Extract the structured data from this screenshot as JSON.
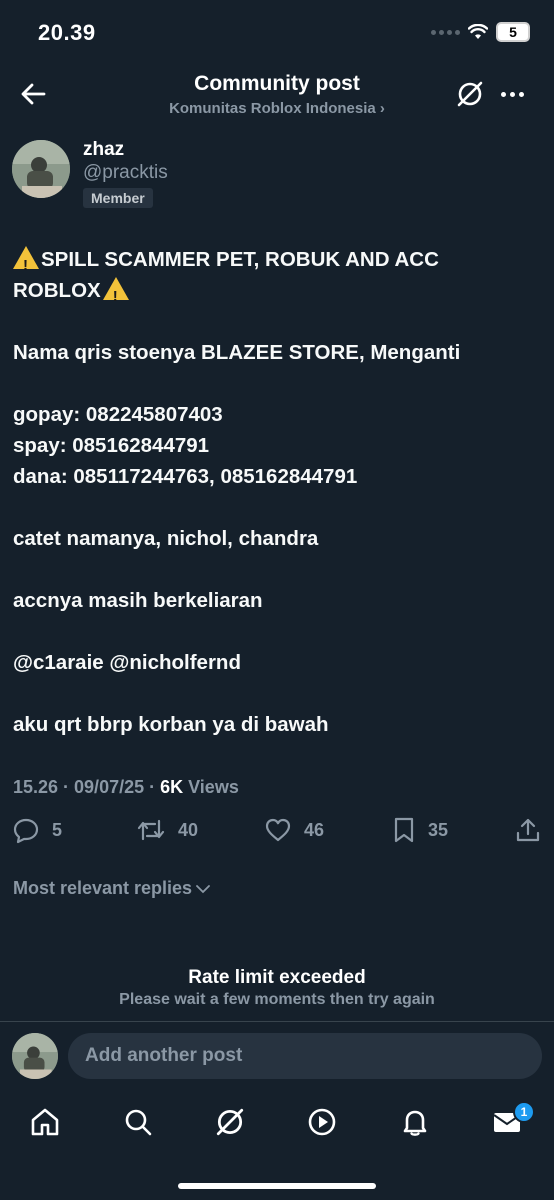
{
  "status_bar": {
    "time": "20.39",
    "battery": "5"
  },
  "header": {
    "title": "Community post",
    "community": "Komunitas Roblox Indonesia ›"
  },
  "author": {
    "name": "zhaz",
    "handle": "@pracktis",
    "badge": "Member"
  },
  "post": {
    "line1": "SPILL SCAMMER PET, ROBUK AND ACC",
    "line2": "ROBLOX",
    "line3": "Nama qris stoenya BLAZEE STORE, Menganti",
    "line4": "gopay: 082245807403",
    "line5": "spay: 085162844791",
    "line6": "dana: 085117244763, 085162844791",
    "line7": "catet namanya, nichol, chandra",
    "line8": "accnya masih berkeliaran",
    "line9": "@c1araie @nicholfernd",
    "line10": "aku qrt bbrp korban ya di bawah"
  },
  "meta": {
    "timestamp": "15.26 · 09/07/25 · ",
    "views_count": "6K",
    "views_label": " Views"
  },
  "actions": {
    "replies": "5",
    "reposts": "40",
    "likes": "46",
    "bookmarks": "35"
  },
  "replies_filter": "Most relevant replies",
  "rate_limit": {
    "title": "Rate limit exceeded",
    "subtitle": "Please wait a few moments then try again"
  },
  "composer": {
    "placeholder": "Add another post"
  },
  "tabbar": {
    "messages_badge": "1"
  },
  "colors": {
    "background": "#15202b",
    "accent": "#1d9bf0",
    "muted": "#8b98a5",
    "warning": "#f2c23a"
  }
}
